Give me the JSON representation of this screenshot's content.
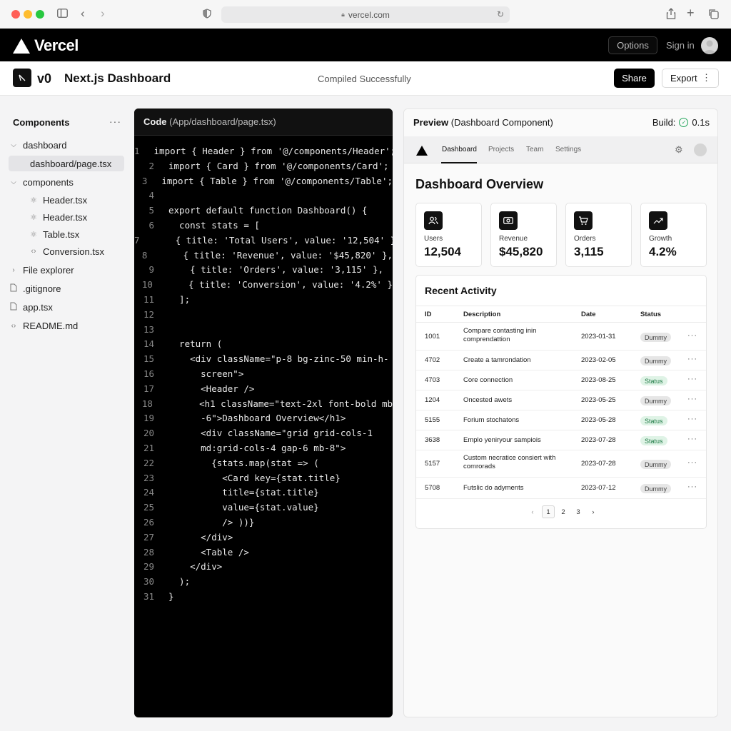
{
  "browser": {
    "url": "vercel.com",
    "traffic_colors": [
      "#ff5f57",
      "#febc2e",
      "#28c840"
    ]
  },
  "topbar": {
    "brand": "Vercel",
    "options_label": "Options",
    "signin_label": "Sign in"
  },
  "project": {
    "logo_text": "v0",
    "name": "Next.js Dashboard",
    "status": "Compiled Successfully",
    "share_label": "Share",
    "export_label": "Export"
  },
  "sidebar": {
    "title": "Components",
    "items": [
      {
        "label": "dashboard",
        "icon": "chevron-down-icon"
      },
      {
        "label": "dashboard/page.tsx",
        "icon": ""
      },
      {
        "label": "components",
        "icon": "chevron-down-icon"
      },
      {
        "label": "Header.tsx",
        "icon": "react-icon"
      },
      {
        "label": "Header.tsx",
        "icon": "react-icon"
      },
      {
        "label": "Table.tsx",
        "icon": "react-icon"
      },
      {
        "label": "Conversion.tsx",
        "icon": "code-icon"
      },
      {
        "label": "File explorer",
        "icon": "chevron-right-icon"
      },
      {
        "label": ".gitignore",
        "icon": "file-icon"
      },
      {
        "label": "app.tsx",
        "icon": "file-icon"
      },
      {
        "label": "README.md",
        "icon": "code-icon"
      }
    ]
  },
  "code": {
    "title": "Code",
    "path": "(App/dashboard/page.tsx)",
    "lines": [
      "import { Header } from '@/components/Header';",
      "import { Card } from '@/components/Card';",
      "import { Table } from '@/components/Table';",
      "",
      "export default function Dashboard() {",
      "  const stats = [",
      "    { title: 'Total Users', value: '12,504' },",
      "    { title: 'Revenue', value: '$45,820' },",
      "    { title: 'Orders', value: '3,115' },",
      "    { title: 'Conversion', value: '4.2%' }",
      "  ];",
      "",
      "",
      "  return (",
      "    <div className=\"p-8 bg-zinc-50 min-h-",
      "      screen\">",
      "      <Header />",
      "      <h1 className=\"text-2xl font-bold mb",
      "      -6\">Dashboard Overview</h1>",
      "      <div className=\"grid grid-cols-1",
      "      md:grid-cols-4 gap-6 mb-8\">",
      "        {stats.map(stat => (",
      "          <Card key={stat.title}",
      "          title={stat.title}",
      "          value={stat.value}",
      "          /> ))}",
      "      </div>",
      "      <Table />",
      "    </div>",
      "  );",
      "}"
    ]
  },
  "preview": {
    "title": "Preview",
    "subtitle": "(Dashboard Component)",
    "build_label": "Build:",
    "build_time": "0.1s",
    "nav": [
      "Dashboard",
      "Projects",
      "Team",
      "Settings"
    ],
    "heading": "Dashboard Overview",
    "stats": [
      {
        "label": "Users",
        "value": "12,504",
        "icon": "users-icon"
      },
      {
        "label": "Revenue",
        "value": "$45,820",
        "icon": "cash-icon"
      },
      {
        "label": "Orders",
        "value": "3,115",
        "icon": "cart-icon"
      },
      {
        "label": "Growth",
        "value": "4.2%",
        "icon": "trend-up-icon"
      }
    ],
    "activity": {
      "title": "Recent Activity",
      "columns": [
        "ID",
        "Description",
        "Date",
        "Status"
      ],
      "rows": [
        {
          "id": "1001",
          "desc": "Compare contasting inin comprendattion",
          "date": "2023-01-31",
          "status": "Dummy"
        },
        {
          "id": "4702",
          "desc": "Create a tamrondation",
          "date": "2023-02-05",
          "status": "Dummy"
        },
        {
          "id": "4703",
          "desc": "Core connection",
          "date": "2023-08-25",
          "status": "Status"
        },
        {
          "id": "1204",
          "desc": "Oncested awets",
          "date": "2023-05-25",
          "status": "Dummy"
        },
        {
          "id": "5155",
          "desc": "Forium stochatons",
          "date": "2023-05-28",
          "status": "Status"
        },
        {
          "id": "3638",
          "desc": "Emplo yeniryour sampiois",
          "date": "2023-07-28",
          "status": "Status"
        },
        {
          "id": "5157",
          "desc": "Custom necratice consiert with comrorads",
          "date": "2023-07-28",
          "status": "Dummy"
        },
        {
          "id": "5708",
          "desc": "Futslic do adyments",
          "date": "2023-07-12",
          "status": "Dummy"
        }
      ],
      "pages": [
        "1",
        "2",
        "3"
      ],
      "current_page": "1"
    }
  }
}
